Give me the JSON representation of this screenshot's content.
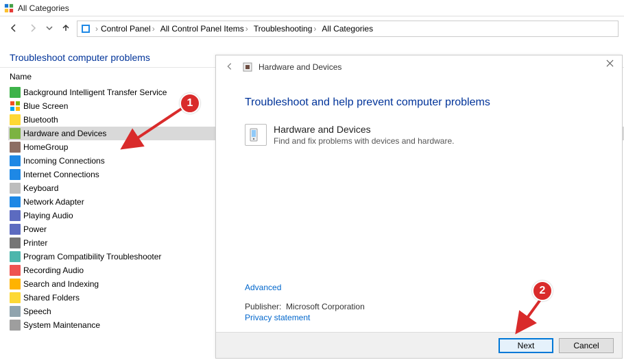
{
  "titlebar": {
    "title": "All Categories"
  },
  "breadcrumbs": [
    "Control Panel",
    "All Control Panel Items",
    "Troubleshooting",
    "All Categories"
  ],
  "page": {
    "heading": "Troubleshoot computer problems",
    "column_header": "Name"
  },
  "list": {
    "selected_index": 3,
    "items": [
      {
        "label": "Background Intelligent Transfer Service",
        "icon_color": "#3eb34a"
      },
      {
        "label": "Blue Screen",
        "icon_color": "windows"
      },
      {
        "label": "Bluetooth",
        "icon_color": "#fdd835"
      },
      {
        "label": "Hardware and Devices",
        "icon_color": "#7cb342"
      },
      {
        "label": "HomeGroup",
        "icon_color": "#8d6e63"
      },
      {
        "label": "Incoming Connections",
        "icon_color": "#1e88e5"
      },
      {
        "label": "Internet Connections",
        "icon_color": "#1e88e5"
      },
      {
        "label": "Keyboard",
        "icon_color": "#bdbdbd"
      },
      {
        "label": "Network Adapter",
        "icon_color": "#1e88e5"
      },
      {
        "label": "Playing Audio",
        "icon_color": "#5c6bc0"
      },
      {
        "label": "Power",
        "icon_color": "#5c6bc0"
      },
      {
        "label": "Printer",
        "icon_color": "#757575"
      },
      {
        "label": "Program Compatibility Troubleshooter",
        "icon_color": "#4db6ac"
      },
      {
        "label": "Recording Audio",
        "icon_color": "#ef5350"
      },
      {
        "label": "Search and Indexing",
        "icon_color": "#ffb300"
      },
      {
        "label": "Shared Folders",
        "icon_color": "#fdd835"
      },
      {
        "label": "Speech",
        "icon_color": "#90a4ae"
      },
      {
        "label": "System Maintenance",
        "icon_color": "#9e9e9e"
      }
    ]
  },
  "dialog": {
    "title": "Hardware and Devices",
    "heading": "Troubleshoot and help prevent computer problems",
    "item_title": "Hardware and Devices",
    "item_desc": "Find and fix problems with devices and hardware.",
    "advanced": "Advanced",
    "publisher_label": "Publisher:",
    "publisher_value": "Microsoft Corporation",
    "privacy": "Privacy statement",
    "next": "Next",
    "cancel": "Cancel"
  },
  "callouts": {
    "one": "1",
    "two": "2"
  }
}
